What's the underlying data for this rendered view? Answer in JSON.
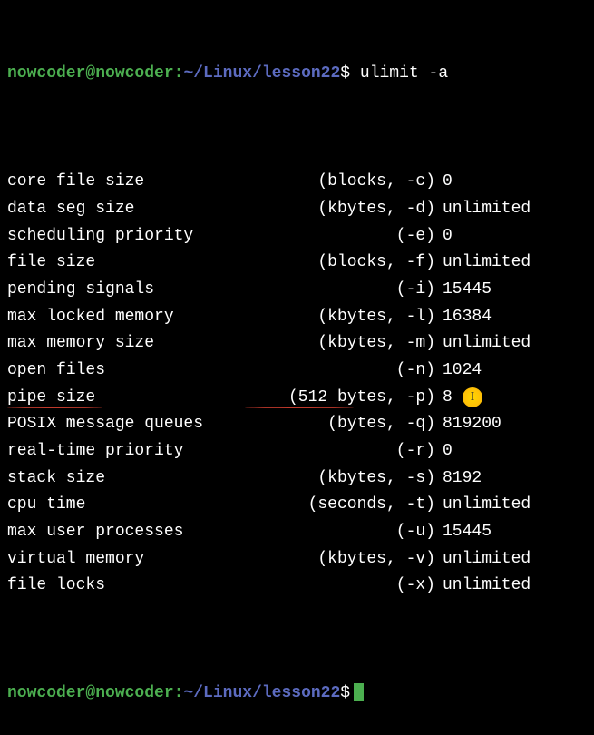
{
  "prompt": {
    "user_host": "nowcoder@nowcoder",
    "separator": ":",
    "path": "~/Linux/lesson22",
    "dollar": "$",
    "command": "ulimit -a"
  },
  "limits": [
    {
      "label": "core file size",
      "spec": "(blocks, -c)",
      "value": "0"
    },
    {
      "label": "data seg size",
      "spec": "(kbytes, -d)",
      "value": "unlimited"
    },
    {
      "label": "scheduling priority",
      "spec": "(-e)",
      "value": "0"
    },
    {
      "label": "file size",
      "spec": "(blocks, -f)",
      "value": "unlimited"
    },
    {
      "label": "pending signals",
      "spec": "(-i)",
      "value": "15445"
    },
    {
      "label": "max locked memory",
      "spec": "(kbytes, -l)",
      "value": "16384"
    },
    {
      "label": "max memory size",
      "spec": "(kbytes, -m)",
      "value": "unlimited"
    },
    {
      "label": "open files",
      "spec": "(-n)",
      "value": "1024"
    },
    {
      "label": "pipe size",
      "spec": "(512 bytes, -p)",
      "value": "8"
    },
    {
      "label": "POSIX message queues",
      "spec": "(bytes, -q)",
      "value": "819200"
    },
    {
      "label": "real-time priority",
      "spec": "(-r)",
      "value": "0"
    },
    {
      "label": "stack size",
      "spec": "(kbytes, -s)",
      "value": "8192"
    },
    {
      "label": "cpu time",
      "spec": "(seconds, -t)",
      "value": "unlimited"
    },
    {
      "label": "max user processes",
      "spec": "(-u)",
      "value": "15445"
    },
    {
      "label": "virtual memory",
      "spec": "(kbytes, -v)",
      "value": "unlimited"
    },
    {
      "label": "file locks",
      "spec": "(-x)",
      "value": "unlimited"
    }
  ],
  "prompt2": {
    "user_host": "nowcoder@nowcoder",
    "separator": ":",
    "path": "~/Linux/lesson22",
    "dollar": "$"
  },
  "highlight": {
    "row_index": 8,
    "cursor_glyph": "I"
  }
}
